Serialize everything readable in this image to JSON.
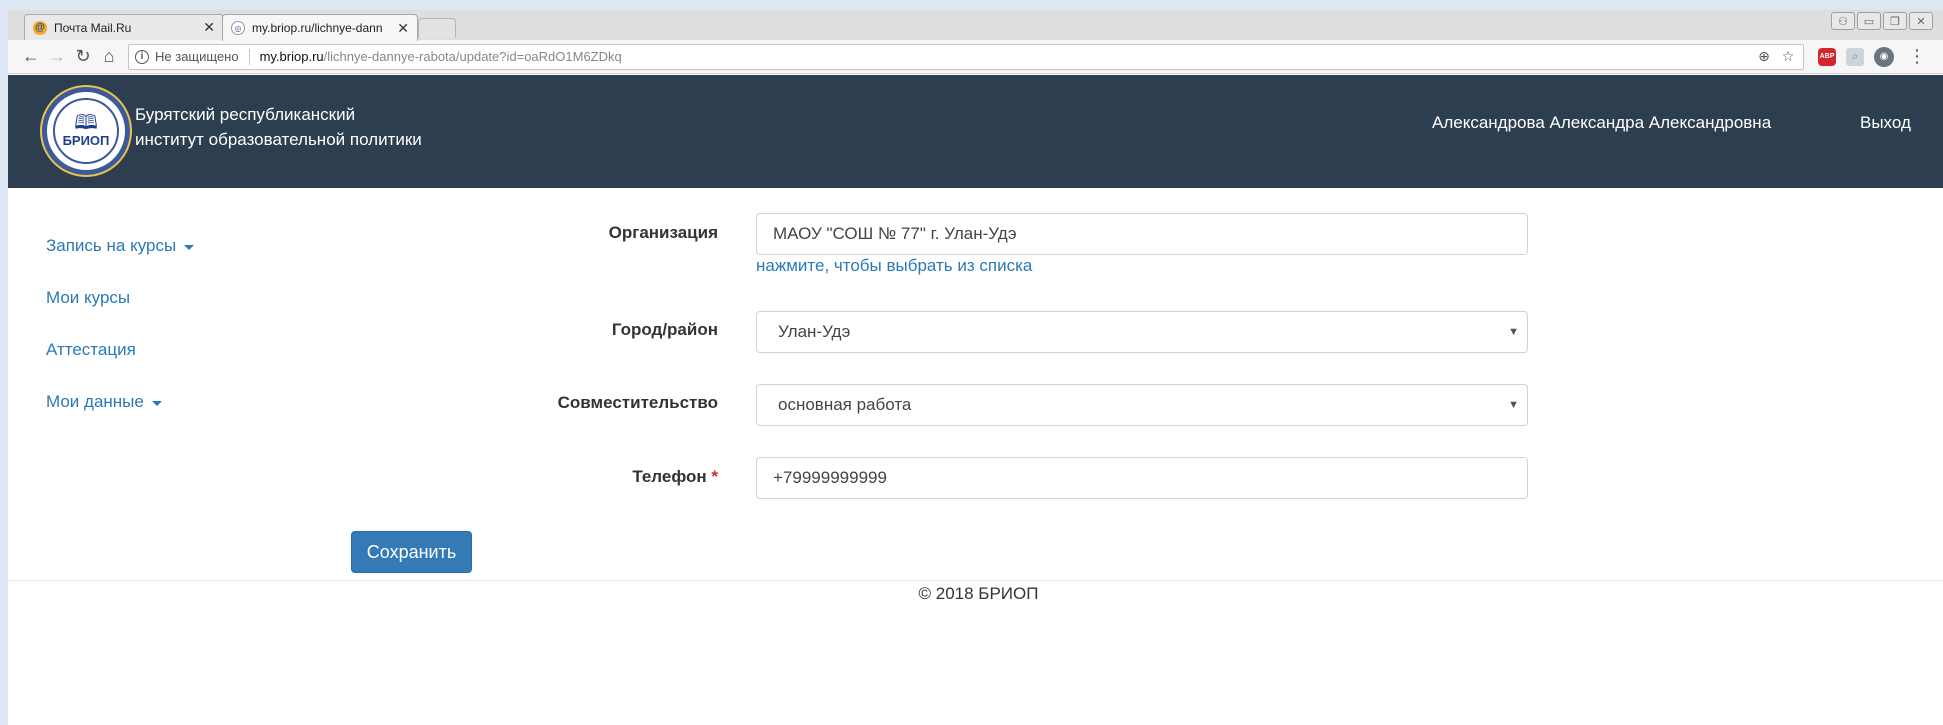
{
  "browser": {
    "tabs": [
      {
        "title": "Почта Mail.Ru",
        "favicon": "mail-ru-icon"
      },
      {
        "title": "my.briop.ru/lichnye-dann",
        "favicon": "briop-icon"
      }
    ],
    "security_label": "Не защищено",
    "url_host": "my.briop.ru",
    "url_path": "/lichnye-dannye-rabota/update?id=oaRdO1M6ZDkq",
    "extension_abp": "ABP"
  },
  "header": {
    "logo_text": "БРИОП",
    "org_line1": "Бурятский республиканский",
    "org_line2": "институт образовательной политики",
    "user_name": "Александрова Александра Александровна",
    "logout_label": "Выход"
  },
  "sidebar": {
    "items": [
      {
        "label": "Запись на курсы",
        "dropdown": true
      },
      {
        "label": "Мои курсы",
        "dropdown": false
      },
      {
        "label": "Аттестация",
        "dropdown": false
      },
      {
        "label": "Мои данные",
        "dropdown": true
      }
    ]
  },
  "form": {
    "organization": {
      "label": "Организация",
      "value": "МАОУ \"СОШ № 77\" г. Улан-Удэ",
      "help": "нажмите, чтобы выбрать из списка"
    },
    "city": {
      "label": "Город/район",
      "value": "Улан-Удэ"
    },
    "employment": {
      "label": "Совместительство",
      "value": "основная работа"
    },
    "phone": {
      "label": "Телефон",
      "required_mark": "*",
      "value": "+79999999999"
    },
    "save_label": "Сохранить"
  },
  "footer": {
    "text": "© 2018 БРИОП"
  },
  "colors": {
    "header_bg": "#2c3e50",
    "link": "#2a7ab8",
    "button": "#337ab7"
  }
}
